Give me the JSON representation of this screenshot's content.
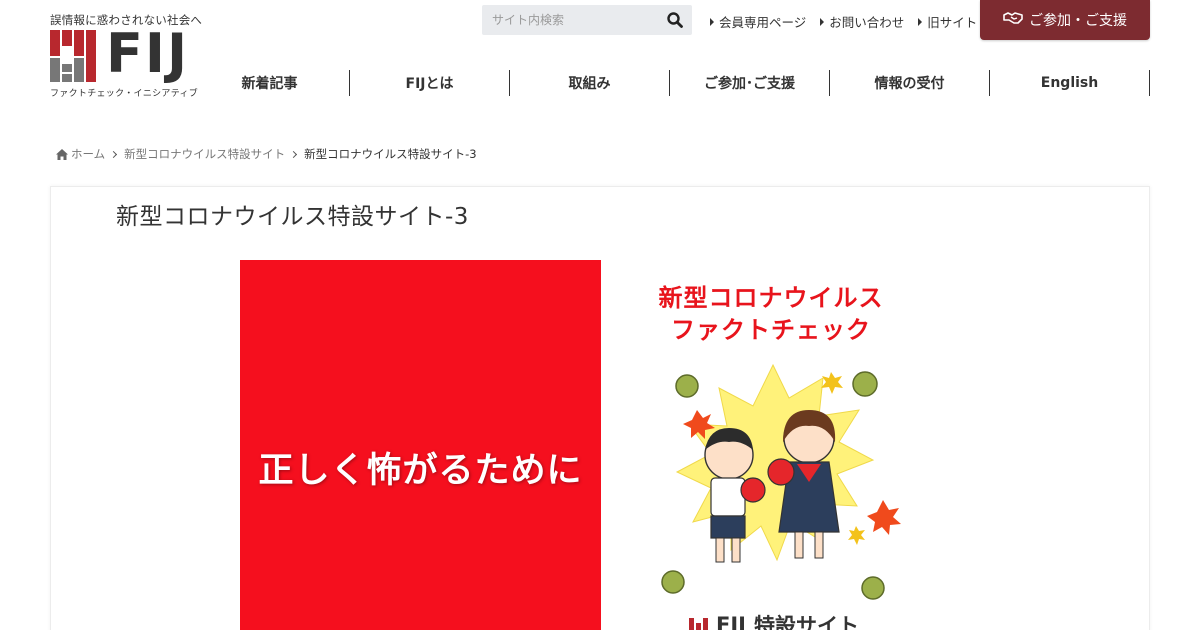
{
  "header": {
    "tagline": "誤情報に惑わされない社会へ",
    "logo_text": "FIJ",
    "logo_sub": "ファクトチェック・イニシアティブ",
    "search_placeholder": "サイト内検索",
    "util_links": [
      "会員専用ページ",
      "お問い合わせ",
      "旧サイト"
    ],
    "join_button": "ご参加・ご支援"
  },
  "nav": {
    "items": [
      "新着記事",
      "FIJとは",
      "取組み",
      "ご参加･ご支援",
      "情報の受付",
      "English"
    ]
  },
  "breadcrumb": {
    "home": "ホーム",
    "parent": "新型コロナウイルス特設サイト",
    "current": "新型コロナウイルス特設サイト-3"
  },
  "post": {
    "title": "新型コロナウイルス特設サイト-3"
  },
  "eyecatch": {
    "left_text": "正しく怖がるために",
    "right_title_line1": "新型コロナウイルス",
    "right_title_line2": "ファクトチェック",
    "bottom_logo": "FIJ",
    "bottom_text": "特設サイト"
  },
  "colors": {
    "brand_dark": "#7d2b30",
    "logo_red": "#b8282e",
    "eyecatch_red": "#f50f1e",
    "burst_yellow": "#fff27a"
  }
}
